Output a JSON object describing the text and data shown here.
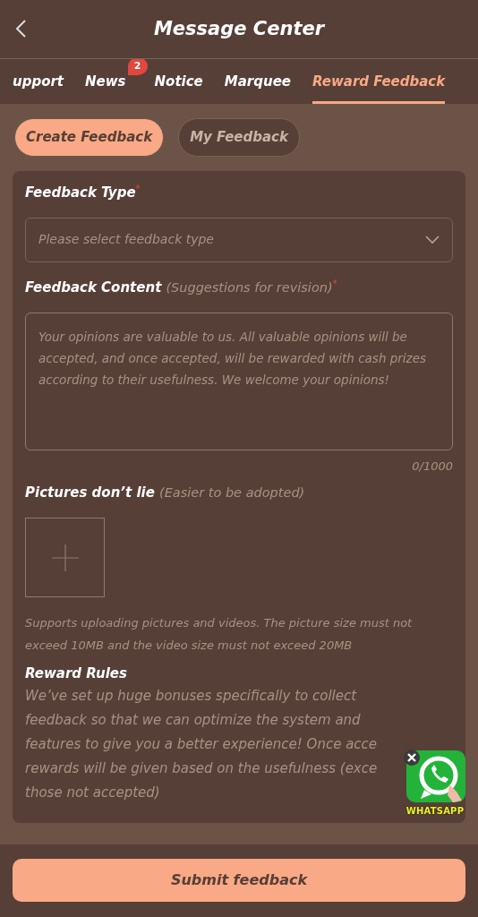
{
  "header": {
    "title": "Message Center"
  },
  "tabs": [
    {
      "label": "upport",
      "selected": false
    },
    {
      "label": "News",
      "selected": false,
      "badge": "2"
    },
    {
      "label": "Notice",
      "selected": false
    },
    {
      "label": "Marquee",
      "selected": false
    },
    {
      "label": "Reward Feedback",
      "selected": true
    }
  ],
  "segments": [
    {
      "label": "Create Feedback",
      "selected": true
    },
    {
      "label": "My Feedback",
      "selected": false
    }
  ],
  "form": {
    "type_label": "Feedback Type",
    "type_required": "*",
    "type_placeholder": "Please select feedback type",
    "content_label": "Feedback Content",
    "content_hint": "(Suggestions for revision)",
    "content_required": "*",
    "content_placeholder": "Your opinions are valuable to us. All valuable opinions will be accepted, and once accepted, will be rewarded with cash prizes according to their usefulness. We welcome your opinions!",
    "counter": "0/1000",
    "pictures_label": "Pictures don’t lie",
    "pictures_hint": "(Easier to be adopted)",
    "upload_note": "Supports uploading pictures and videos. The picture size must not exceed 10MB and the video size must not exceed 20MB",
    "rules_title": "Reward Rules",
    "rules_lines": [
      "We’ve set up huge bonuses specifically to collect",
      "feedback so that we can optimize the system and",
      "features to give you a better experience! Once acce",
      "rewards will be given based on the usefulness (exce",
      "those not accepted)"
    ]
  },
  "whatsapp": {
    "label": "WHATSAPP"
  },
  "submit": {
    "label": "Submit feedback"
  }
}
